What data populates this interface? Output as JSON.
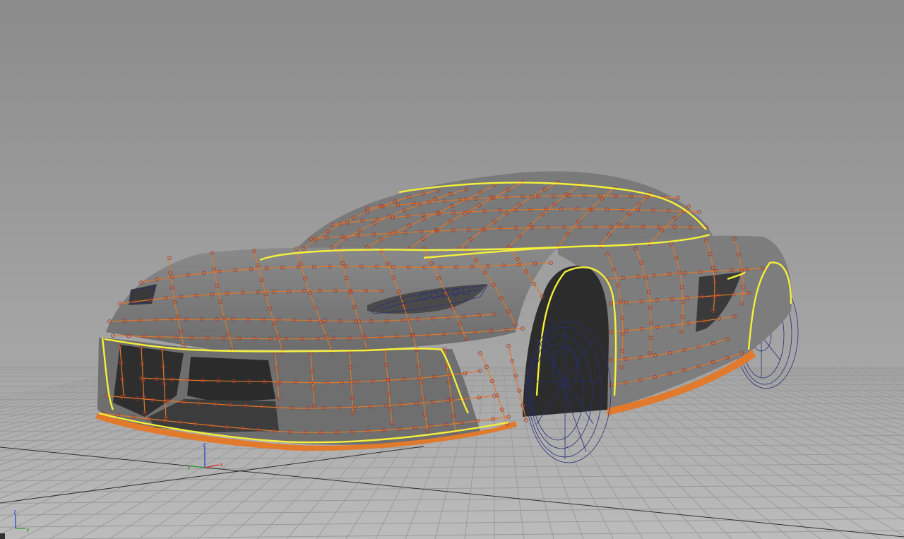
{
  "viewport": {
    "background_top": "#8c8c8c",
    "background_bottom": "#b9b9b9",
    "grid_color": "#9e9e9e",
    "grid_major_color": "#2f2f2f"
  },
  "model": {
    "surface_color": "#7b7b7b",
    "surface_dark": "#3a3a3a",
    "cv_hull_color": "#e0782a",
    "cv_point_color": "#a83a2a",
    "edge_highlight_color": "#f5f03a",
    "wheel_wire_color": "#2a2f7a"
  },
  "axes_gizmo": {
    "x": "x",
    "y": "y",
    "z": "z",
    "x_color": "#d22828",
    "y_color": "#2a9a2a",
    "z_color": "#2a3ad2"
  },
  "corner_gizmo": {
    "z": "z",
    "y": "y"
  }
}
